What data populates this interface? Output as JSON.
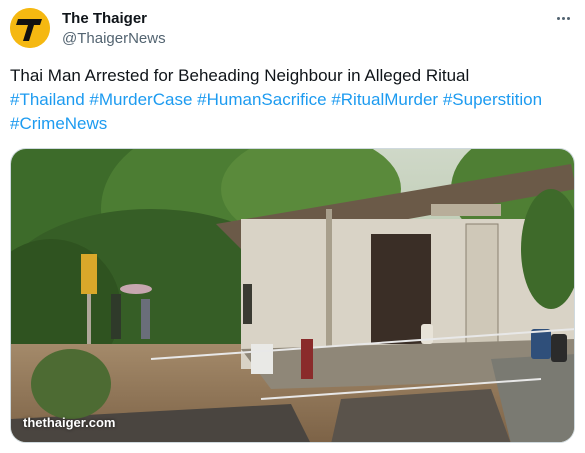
{
  "author": {
    "display_name": "The Thaiger",
    "handle": "@ThaigerNews",
    "avatar_letter": "T",
    "avatar_color": "#f5b811"
  },
  "tweet": {
    "text": "Thai Man Arrested for Beheading Neighbour in Alleged Ritual",
    "hashtags_line1": [
      "#Thailand",
      "#MurderCase",
      "#HumanSacrifice",
      "#RitualMurder",
      "#Superstition"
    ],
    "hashtags_line2": [
      "#CrimeNews"
    ]
  },
  "media": {
    "watermark": "thethaiger.com"
  },
  "icons": {
    "more": "more-dots-icon",
    "avatar": "thaiger-logo-icon"
  },
  "colors": {
    "hashtag": "#1d9bf0",
    "secondary_text": "#536471"
  }
}
